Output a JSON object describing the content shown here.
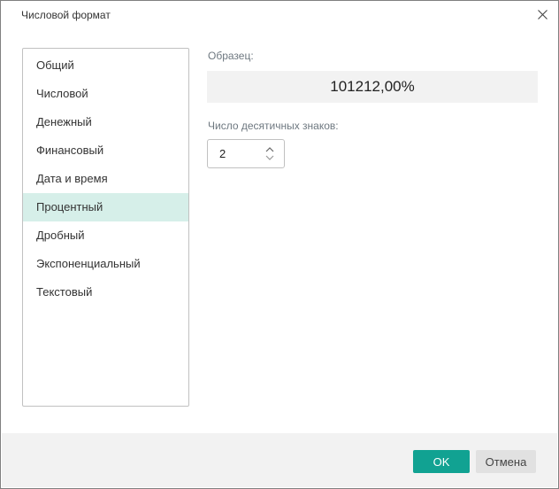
{
  "colors": {
    "accent": "#11a292",
    "selection": "#d6efe9",
    "neutral-bg": "#f2f2f2",
    "button-gray": "#e1e1e1",
    "border-gray": "#c1c1c1",
    "window-border": "#808080",
    "muted": "#6e7880"
  },
  "window": {
    "title": "Числовой формат"
  },
  "category_list": {
    "items": [
      {
        "id": "general",
        "label": "Общий",
        "selected": false
      },
      {
        "id": "number",
        "label": "Числовой",
        "selected": false
      },
      {
        "id": "currency",
        "label": "Денежный",
        "selected": false
      },
      {
        "id": "accounting",
        "label": "Финансовый",
        "selected": false
      },
      {
        "id": "date-time",
        "label": "Дата и время",
        "selected": false
      },
      {
        "id": "percentage",
        "label": "Процентный",
        "selected": true
      },
      {
        "id": "fraction",
        "label": "Дробный",
        "selected": false
      },
      {
        "id": "scientific",
        "label": "Экспоненциальный",
        "selected": false
      },
      {
        "id": "text",
        "label": "Текстовый",
        "selected": false
      }
    ]
  },
  "sample": {
    "label": "Образец:",
    "value": "101212,00%"
  },
  "decimal_places": {
    "label": "Число десятичных знаков:",
    "value": "2"
  },
  "footer": {
    "ok_label": "OK",
    "cancel_label": "Отмена"
  }
}
